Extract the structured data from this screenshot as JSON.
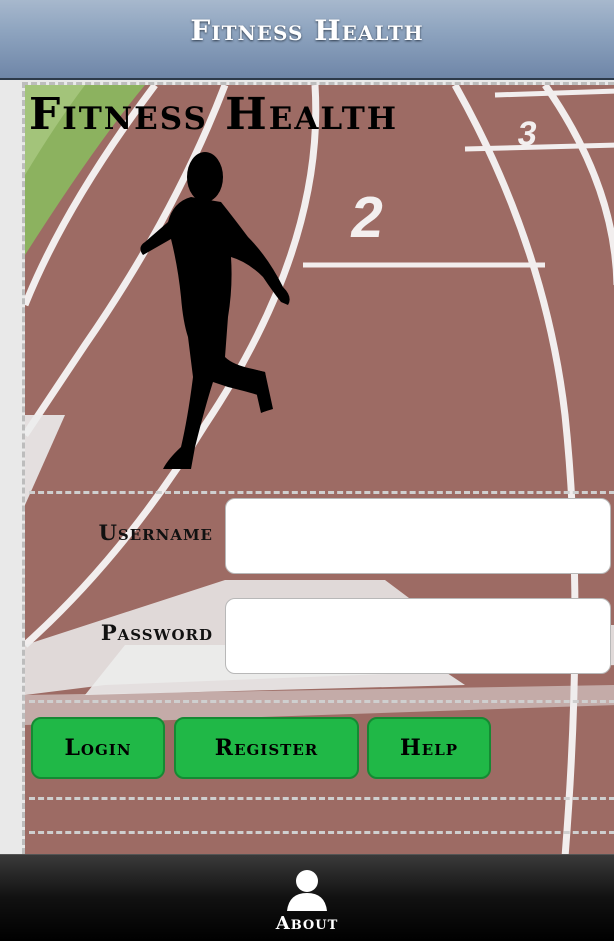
{
  "header": {
    "title": "Fitness Health"
  },
  "main": {
    "heading": "Fitness Health",
    "lane_number": "2",
    "lane_number_far": "3"
  },
  "form": {
    "username_label": "Username",
    "password_label": "Password",
    "username_value": "",
    "password_value": ""
  },
  "buttons": {
    "login": "Login",
    "register": "Register",
    "help": "Help"
  },
  "footer": {
    "about_label": "About",
    "about_icon": "user-icon"
  }
}
